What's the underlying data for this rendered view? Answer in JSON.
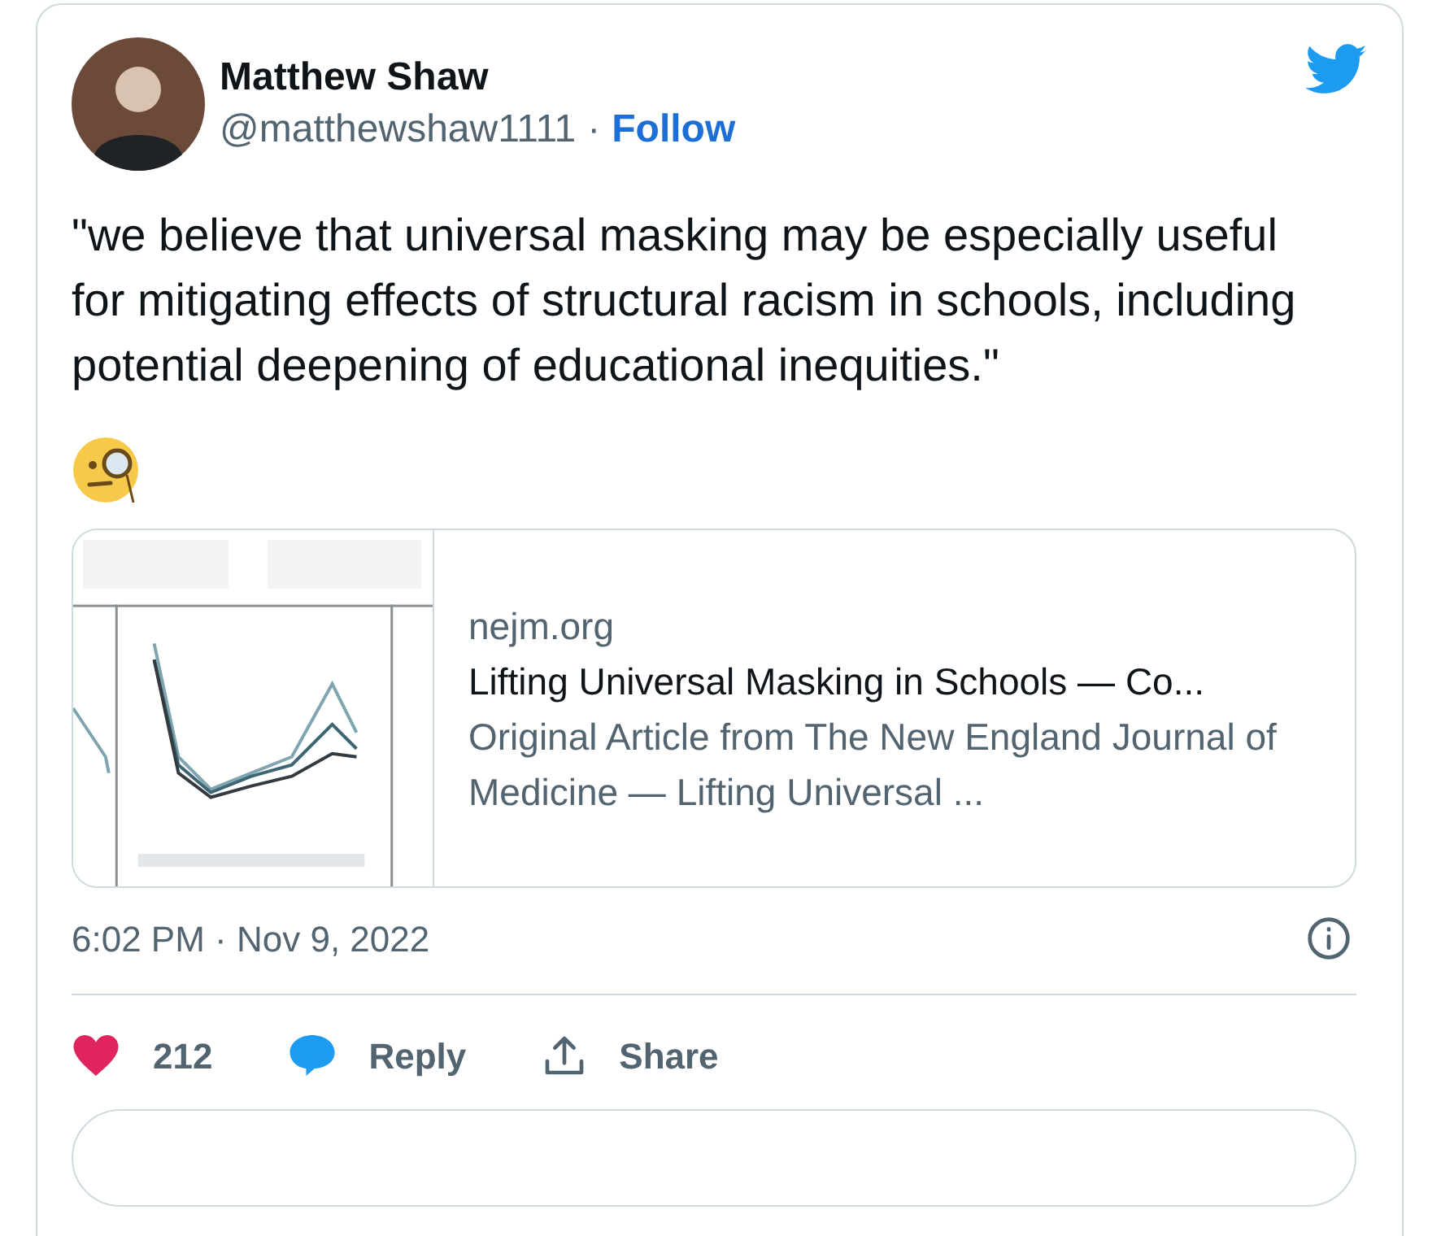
{
  "author": {
    "name": "Matthew Shaw",
    "handle": "@matthewshaw1111",
    "separator": "·",
    "follow": "Follow"
  },
  "text": "\"we believe that universal masking may be especially useful for mitigating effects of structural racism in schools, including potential deepening of educational inequities.\"",
  "link_card": {
    "domain": "nejm.org",
    "title": "Lifting Universal Masking in Schools — Co...",
    "description": "Original Article from The New England Journal of Medicine — Lifting Universal ..."
  },
  "timestamp": "6:02 PM · Nov 9, 2022",
  "actions": [
    {
      "kind": "like",
      "label": "212"
    },
    {
      "kind": "reply",
      "label": "Reply"
    },
    {
      "kind": "share",
      "label": "Share"
    }
  ]
}
